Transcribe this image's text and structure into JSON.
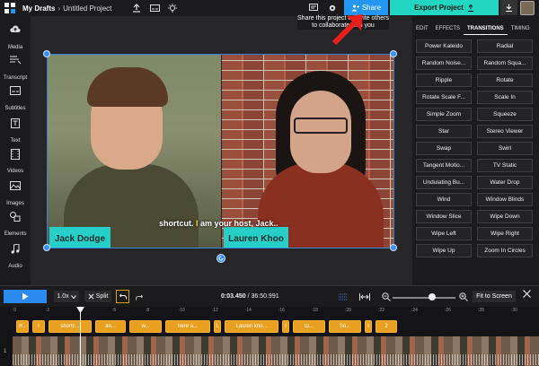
{
  "topbar": {
    "breadcrumb_root": "My Drafts",
    "breadcrumb_sep": "›",
    "project_name": "Untitled Project",
    "share_label": "Share",
    "export_label": "Export Project"
  },
  "tooltip": {
    "text": "Share this project to invite others to collaborate with you"
  },
  "sidebar": {
    "items": [
      {
        "label": "Media",
        "icon": "cloud-upload-icon"
      },
      {
        "label": "Transcript",
        "icon": "transcript-icon"
      },
      {
        "label": "Subtitles",
        "icon": "subtitles-icon"
      },
      {
        "label": "Text",
        "icon": "text-icon"
      },
      {
        "label": "Videos",
        "icon": "film-icon"
      },
      {
        "label": "Images",
        "icon": "image-icon"
      },
      {
        "label": "Elements",
        "icon": "shapes-icon"
      },
      {
        "label": "Audio",
        "icon": "music-icon"
      }
    ]
  },
  "canvas": {
    "caption_text_a": "shortcut. ",
    "caption_highlight": "I",
    "caption_text_b": " am your host, Jack..",
    "name_left": "Jack Dodge",
    "name_right": "Lauren Khoo"
  },
  "right_panel": {
    "tabs": [
      {
        "label": "EDIT",
        "active": false
      },
      {
        "label": "EFFECTS",
        "active": false
      },
      {
        "label": "TRANSITIONS",
        "active": true
      },
      {
        "label": "TIMING",
        "active": false
      }
    ],
    "transitions": [
      "Power Kaleido",
      "Radial",
      "Random Noise...",
      "Random Squa...",
      "Ripple",
      "Rotate",
      "Rotate Scale F...",
      "Scale In",
      "Simple Zoom",
      "Squeeze",
      "Star",
      "Stereo Viewer",
      "Swap",
      "Swirl",
      "Tangent Motio...",
      "TV Static",
      "Undulating Bu...",
      "Water Drop",
      "Wind",
      "Window Blinds",
      "Window Slice",
      "Wipe Down",
      "Wipe Left",
      "Wipe Right",
      "Wipe Up",
      "Zoom In Circles"
    ]
  },
  "timeline": {
    "speed": "1.0x",
    "split_label": "Split",
    "current_time": "0:03.450",
    "total_time": " / 36:50.991",
    "fit_label": "Fit to Screen",
    "ruler_marks": [
      ":0",
      ":2",
      ":4",
      ":6",
      ":8",
      ":10",
      ":12",
      ":14",
      ":16",
      ":18",
      ":20",
      ":22",
      ":24",
      ":26",
      ":28",
      ":30",
      ":32",
      ":34",
      ":36"
    ],
    "track_numbers": [
      "1"
    ],
    "subtitle_clips": [
      "H..",
      "I",
      "shortc...",
      "an...",
      "w...",
      "here a...",
      "I.",
      "Lauren kno...",
      "I",
      "to...",
      "So...",
      "I",
      "2"
    ]
  },
  "colors": {
    "accent_blue": "#2196f3",
    "export_teal": "#23d6c2",
    "subtitle_orange": "#e9a020",
    "name_tag_teal": "#26d0c8"
  }
}
